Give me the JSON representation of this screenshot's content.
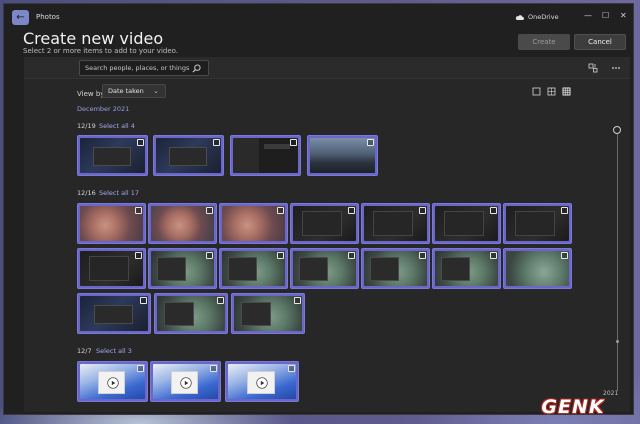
{
  "app": {
    "name": "Photos",
    "cloud_label": "OneDrive",
    "window_controls": {
      "minimize": "—",
      "maximize": "☐",
      "close": "✕"
    }
  },
  "header": {
    "title": "Create new video",
    "subtitle": "Select 2 or more items to add to your video.",
    "create_label": "Create",
    "cancel_label": "Cancel"
  },
  "toolbar": {
    "search_placeholder": "Search people, places, or things..."
  },
  "view": {
    "label": "View by:",
    "selected": "Date taken",
    "month": "December 2021"
  },
  "groups": [
    {
      "date": "12/19",
      "select_all": "Select all 4"
    },
    {
      "date": "12/16",
      "select_all": "Select all 17"
    },
    {
      "date": "12/7",
      "select_all": "Select all 3"
    }
  ],
  "timeline": {
    "year": "2021"
  },
  "watermark": "GENK"
}
